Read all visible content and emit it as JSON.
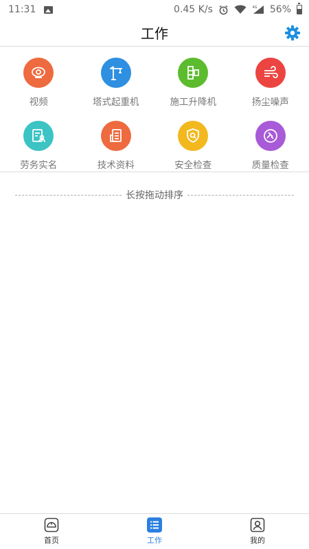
{
  "status_bar": {
    "time": "11:31",
    "network_speed": "0.45 K/s",
    "battery_percent": "56%"
  },
  "header": {
    "title": "工作",
    "settings_icon": "gear-icon"
  },
  "grid": {
    "items": [
      {
        "label": "视频",
        "icon": "video-camera-icon",
        "color": "#ee6a3f"
      },
      {
        "label": "塔式起重机",
        "icon": "tower-crane-icon",
        "color": "#2f8fe0"
      },
      {
        "label": "施工升降机",
        "icon": "construction-elevator-icon",
        "color": "#5cbc2d"
      },
      {
        "label": "扬尘噪声",
        "icon": "dust-noise-icon",
        "color": "#ec4440"
      },
      {
        "label": "劳务实名",
        "icon": "labor-realname-icon",
        "color": "#3cc3c4"
      },
      {
        "label": "技术资料",
        "icon": "technical-documents-icon",
        "color": "#ee6a3f"
      },
      {
        "label": "安全检查",
        "icon": "safety-check-icon",
        "color": "#f2b81e"
      },
      {
        "label": "质量检查",
        "icon": "quality-check-icon",
        "color": "#a85ad8"
      }
    ]
  },
  "sort_hint": "长按拖动排序",
  "bottom_nav": {
    "items": [
      {
        "label": "首页",
        "icon": "home-helmet-icon"
      },
      {
        "label": "工作",
        "icon": "work-list-icon"
      },
      {
        "label": "我的",
        "icon": "profile-icon"
      }
    ],
    "active_label": "工作",
    "active_color": "#2b7fe0"
  }
}
